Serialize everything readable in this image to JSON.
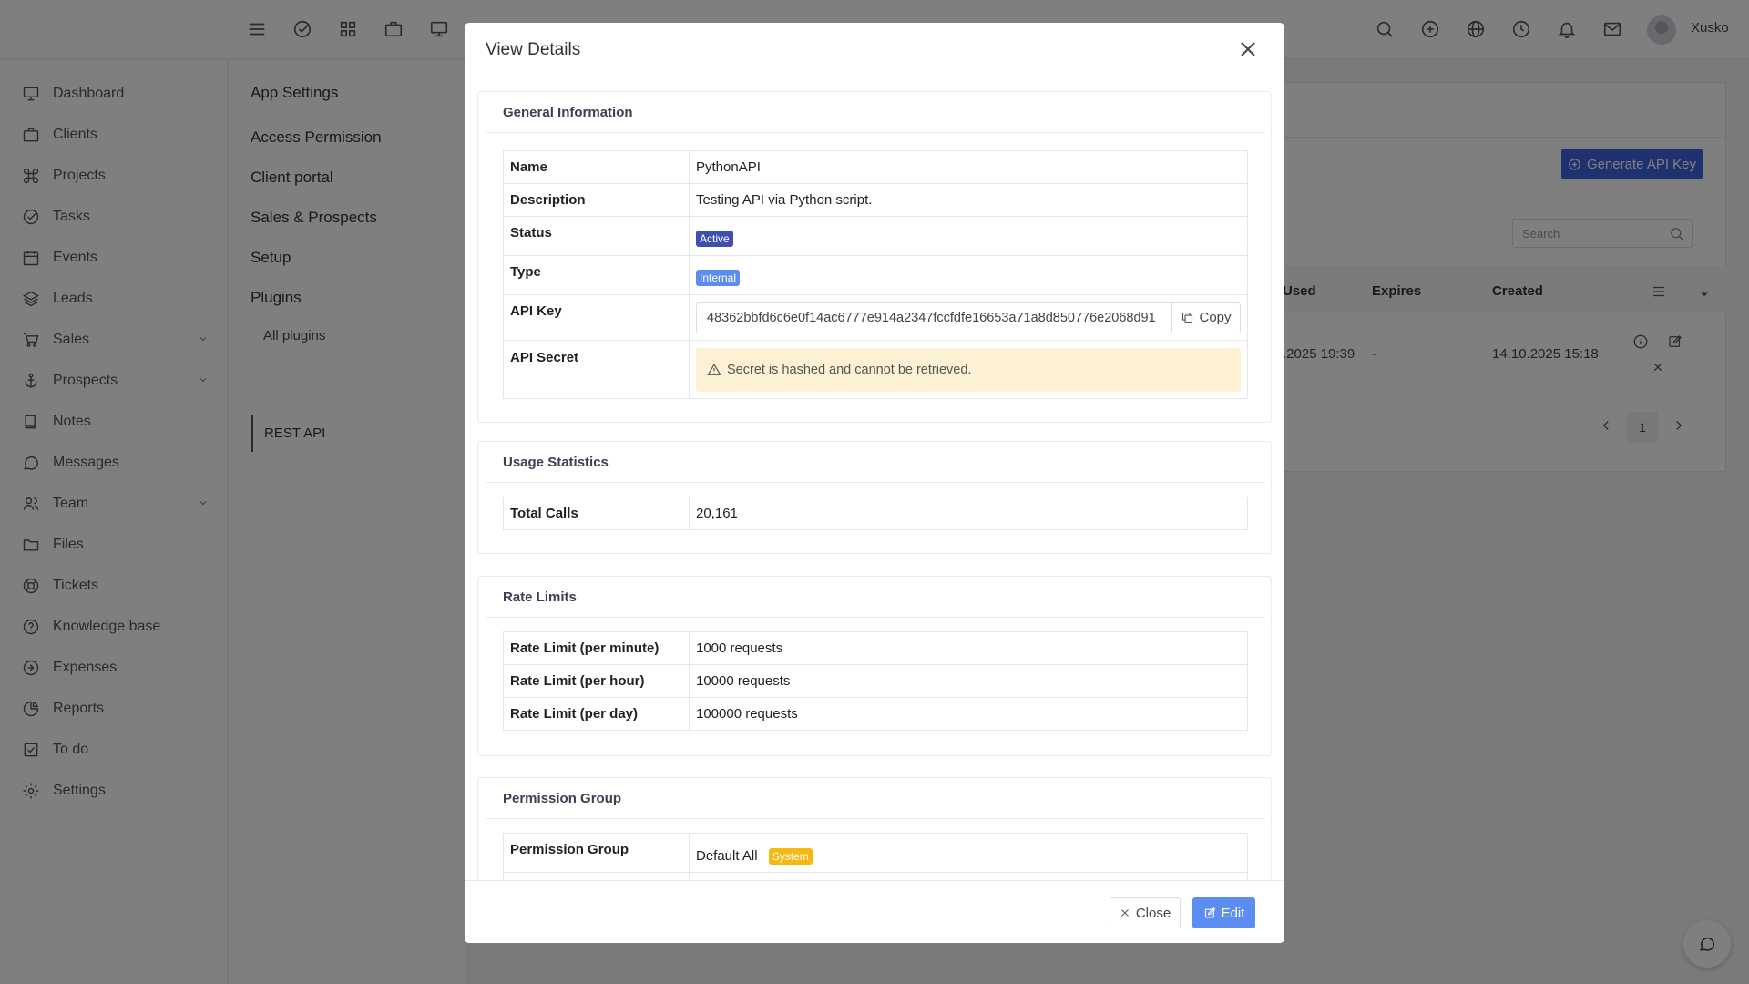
{
  "topbar": {
    "username": "Xusko"
  },
  "sidebar": {
    "items": [
      {
        "label": "Dashboard",
        "icon": "monitor-icon"
      },
      {
        "label": "Clients",
        "icon": "briefcase-icon"
      },
      {
        "label": "Projects",
        "icon": "command-icon"
      },
      {
        "label": "Tasks",
        "icon": "check-circle-icon"
      },
      {
        "label": "Events",
        "icon": "calendar-icon"
      },
      {
        "label": "Leads",
        "icon": "layers-icon"
      },
      {
        "label": "Sales",
        "icon": "cart-icon"
      },
      {
        "label": "Prospects",
        "icon": "anchor-icon"
      },
      {
        "label": "Notes",
        "icon": "book-icon"
      },
      {
        "label": "Messages",
        "icon": "message-icon"
      },
      {
        "label": "Team",
        "icon": "users-icon"
      },
      {
        "label": "Files",
        "icon": "folder-icon"
      },
      {
        "label": "Tickets",
        "icon": "life-buoy-icon"
      },
      {
        "label": "Knowledge base",
        "icon": "help-circle-icon"
      },
      {
        "label": "Expenses",
        "icon": "arrow-circle-icon"
      },
      {
        "label": "Reports",
        "icon": "pie-chart-icon"
      },
      {
        "label": "To do",
        "icon": "check-square-icon"
      },
      {
        "label": "Settings",
        "icon": "gear-icon"
      }
    ]
  },
  "settings_menu": {
    "app_settings": "App Settings",
    "access_permission": "Access Permission",
    "client_portal": "Client portal",
    "sales_prospects": "Sales & Prospects",
    "setup": "Setup",
    "plugins": "Plugins",
    "all_plugins": "All plugins",
    "rest_api": "REST API"
  },
  "background": {
    "generate_button": "Generate API Key",
    "search_placeholder": "Search",
    "col_used": "Used",
    "col_expires": "Expires",
    "col_created": "Created",
    "row_used": ".2025 19:39",
    "row_expires": "-",
    "row_created": "14.10.2025 15:18",
    "page": "1"
  },
  "modal": {
    "title": "View Details",
    "general": {
      "title": "General Information",
      "name_label": "Name",
      "name_value": "PythonAPI",
      "description_label": "Description",
      "description_value": "Testing API via Python script.",
      "status_label": "Status",
      "status_value": "Active",
      "type_label": "Type",
      "type_value": "Internal",
      "api_key_label": "API Key",
      "api_key_value": "48362bbfd6c6e0f14ac6777e914a2347fccfdfe16653a71a8d850776e2068d91",
      "copy_label": "Copy",
      "api_secret_label": "API Secret",
      "api_secret_warning": "Secret is hashed and cannot be retrieved."
    },
    "usage": {
      "title": "Usage Statistics",
      "total_calls_label": "Total Calls",
      "total_calls_value": "20,161"
    },
    "rate_limits": {
      "title": "Rate Limits",
      "per_minute_label": "Rate Limit (per minute)",
      "per_minute_value": "1000 requests",
      "per_hour_label": "Rate Limit (per hour)",
      "per_hour_value": "10000 requests",
      "per_day_label": "Rate Limit (per day)",
      "per_day_value": "100000 requests"
    },
    "permission": {
      "title": "Permission Group",
      "group_label": "Permission Group",
      "group_value": "Default All",
      "group_badge": "System"
    },
    "footer": {
      "close_label": "Close",
      "edit_label": "Edit"
    }
  },
  "colors": {
    "primary": "#3e63dd",
    "badge_active": "#3e4fb0",
    "badge_internal": "#5b8def",
    "badge_system": "#f5b914",
    "warning_bg": "#fcf1d2",
    "edit_button": "#5c8df0"
  }
}
